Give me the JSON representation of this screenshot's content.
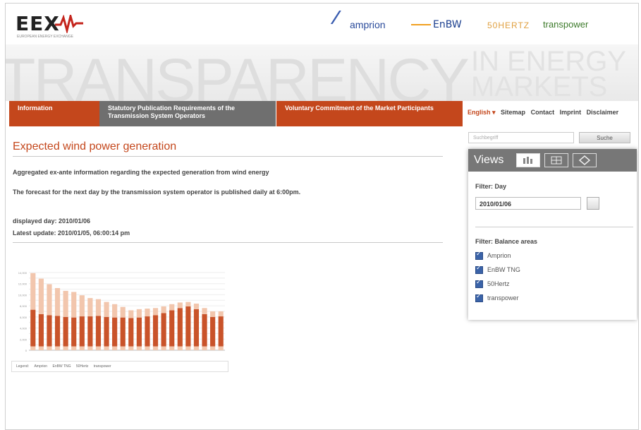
{
  "header": {
    "logo_text": "EEX",
    "logo_subtext": "EUROPEAN ENERGY EXCHANGE",
    "partners": {
      "amprion": "amprion",
      "enbw": "EnBW",
      "fiftyhertz": "50HERTZ",
      "transpower": "transpower"
    }
  },
  "banner": {
    "big": "TRANSPARENCY",
    "small_line1": "IN ENERGY",
    "small_line2": "MARKETS"
  },
  "nav": [
    {
      "label": "Information"
    },
    {
      "label": "Statutory Publication Requirements of the Transmission System Operators"
    },
    {
      "label": "Voluntary Commitment of the Market Participants"
    }
  ],
  "meta_links": {
    "language": "English ▾",
    "sitemap": "Sitemap",
    "contact": "Contact",
    "imprint": "Imprint",
    "disclaimer": "Disclaimer"
  },
  "search": {
    "placeholder": "Suchbegriff",
    "button": "Suche"
  },
  "main": {
    "title": "Expected wind power generation",
    "description1": "Aggregated ex-ante information regarding the expected generation from wind energy",
    "description2": "The forecast for the next day by the transmission system operator is published daily at 6:00pm.",
    "displayed_day": "displayed day: 2010/01/06",
    "latest_update": "Latest update: 2010/01/05, 06:00:14 pm"
  },
  "views": {
    "label": "Views",
    "filter_day_title": "Filter: Day",
    "date_value": "2010/01/06",
    "filter_areas_title": "Filter: Balance areas",
    "areas": [
      "Amprion",
      "EnBW TNG",
      "50Hertz",
      "transpower"
    ]
  },
  "colors": {
    "accent": "#c4471c",
    "bar_dark": "#c9532a",
    "bar_light": "#f2c6ad",
    "nav_gray": "#6f6f6f"
  },
  "chart_data": {
    "type": "bar",
    "stacked": true,
    "ylim": [
      0,
      14000
    ],
    "yticks": [
      0,
      1000,
      2000,
      3000,
      4000,
      5000,
      6000,
      7000,
      8000,
      9000,
      10000,
      11000,
      12000,
      13000,
      14000
    ],
    "series": [
      {
        "name": "Amprion",
        "values": [
          200,
          200,
          200,
          200,
          200,
          200,
          200,
          200,
          200,
          200,
          200,
          200,
          200,
          200,
          200,
          200,
          200,
          200,
          200,
          200,
          200,
          200,
          200,
          200
        ]
      },
      {
        "name": "EnBW TNG",
        "values": [
          500,
          500,
          500,
          500,
          500,
          500,
          500,
          500,
          500,
          500,
          500,
          500,
          500,
          500,
          500,
          500,
          500,
          500,
          500,
          500,
          500,
          500,
          500,
          500
        ]
      },
      {
        "name": "50Hertz",
        "values": [
          6600,
          5800,
          5600,
          5500,
          5300,
          5200,
          5400,
          5400,
          5500,
          5300,
          5200,
          5200,
          5100,
          5200,
          5400,
          5600,
          6000,
          6500,
          6900,
          7200,
          6700,
          5800,
          5300,
          5400
        ]
      },
      {
        "name": "transpower",
        "values": [
          6600,
          6400,
          5600,
          5000,
          4700,
          4600,
          3800,
          3300,
          3000,
          2700,
          2400,
          1900,
          1400,
          1500,
          1400,
          1300,
          1200,
          1100,
          1000,
          800,
          1000,
          1100,
          1000,
          900
        ]
      }
    ]
  }
}
